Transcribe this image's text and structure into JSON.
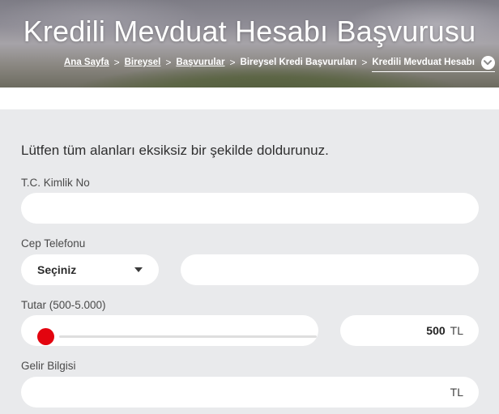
{
  "header": {
    "title": "Kredili Mevduat Hesabı Başvurusu",
    "breadcrumb": {
      "items": [
        "Ana Sayfa",
        "Bireysel",
        "Başvurular",
        "Bireysel Kredi Başvuruları"
      ],
      "current": "Kredili Mevduat Hesabı",
      "separator": ">"
    }
  },
  "form": {
    "intro": "Lütfen tüm alanları eksiksiz bir şekilde doldurunuz.",
    "tc_label": "T.C. Kimlik No",
    "tc_value": "",
    "phone_label": "Cep Telefonu",
    "phone_prefix_selected": "Seçiniz",
    "phone_value": "",
    "amount_label": "Tutar (500-5.000)",
    "amount_value": "500",
    "amount_min": 500,
    "amount_max": 5000,
    "amount_currency": "TL",
    "income_label": "Gelir Bilgisi",
    "income_value": "",
    "income_currency": "TL"
  },
  "colors": {
    "accent": "#e3040f",
    "panel_bg": "#e9eaec",
    "field_bg": "#ffffff"
  },
  "icons": {
    "dropdown": "caret-down-icon",
    "breadcrumb_toggle": "chevron-down-icon"
  }
}
